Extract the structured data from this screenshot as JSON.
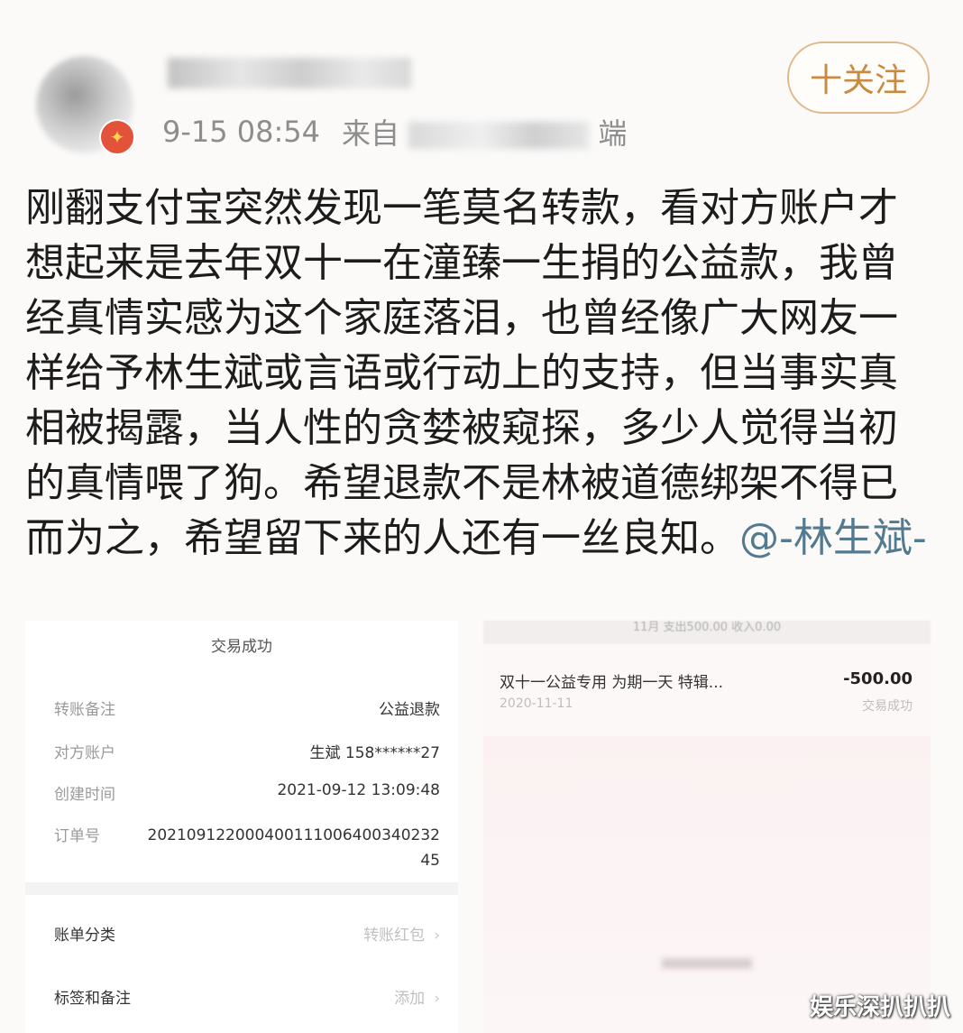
{
  "post": {
    "time": "9-15 08:54",
    "source_prefix": "来自",
    "source_suffix": "端",
    "follow_label": "十关注",
    "text": "刚翻支付宝突然发现一笔莫名转款，看对方账户才想起来是去年双十一在潼臻一生捐的公益款，我曾经真情实感为这个家庭落泪，也曾经像广大网友一样给予林生斌或言语或行动上的支持，但当事实真相被揭露，当人性的贪婪被窥探，多少人觉得当初的真情喂了狗。希望退款不是林被道德绑架不得已而为之，希望留下来的人还有一丝良知。",
    "mention": "@-林生斌-"
  },
  "left_shot": {
    "title": "交易成功",
    "rows": [
      {
        "label": "转账备注",
        "value": "公益退款"
      },
      {
        "label": "对方账户",
        "value": "生斌 158******27"
      },
      {
        "label": "创建时间",
        "value": "2021-09-12 13:09:48"
      },
      {
        "label": "订单号",
        "value": "20210912200040011100640034023245"
      }
    ],
    "bill_category_label": "账单分类",
    "bill_category_value": "转账红包",
    "tags_label": "标签和备注",
    "tags_value": "添加"
  },
  "right_shot": {
    "summary": "11月  支出500.00  收入0.00",
    "item_title": "双十一公益专用 为期一天 特辑...",
    "item_amount": "-500.00",
    "item_date": "2020-11-11",
    "item_status": "交易成功"
  },
  "watermark": "娱乐深扒扒扒"
}
